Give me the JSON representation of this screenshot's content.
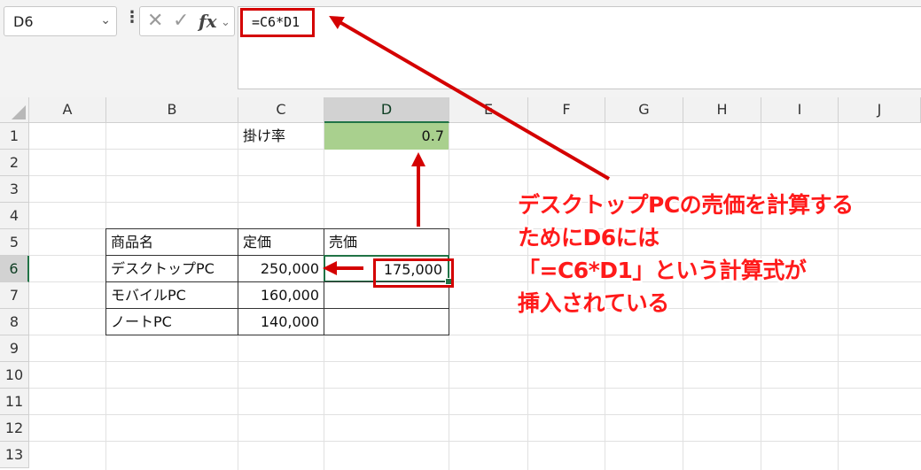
{
  "formula_bar": {
    "name_box": "D6",
    "formula": "=C6*D1",
    "icons": {
      "menu": "vertical-dots-icon",
      "cancel": "x-icon",
      "enter": "check-icon",
      "function": "fx-icon",
      "expand": "chevron-down-icon"
    }
  },
  "sheet": {
    "columns": [
      "A",
      "B",
      "C",
      "D",
      "E",
      "F",
      "G",
      "H",
      "I",
      "J"
    ],
    "selected_column": "D",
    "rows": [
      "1",
      "2",
      "3",
      "4",
      "5",
      "6",
      "7",
      "8",
      "9",
      "10",
      "11",
      "12",
      "13"
    ],
    "selected_row": "6",
    "cells": {
      "C1": "掛け率",
      "D1": "0.7",
      "B5": "商品名",
      "C5": "定価",
      "D5": "売価",
      "B6": "デスクトップPC",
      "C6": "250,000",
      "D6": "175,000",
      "B7": "モバイルPC",
      "C7": "160,000",
      "B8": "ノートPC",
      "C8": "140,000"
    }
  },
  "annotation": {
    "lines": [
      "デスクトップPCの売価を計算する",
      "ためにD6には",
      "「=C6*D1」という計算式が",
      "挿入されている"
    ]
  },
  "colors": {
    "highlight_red": "#d40000",
    "annotation_red": "#ff1a1a",
    "cell_fill_green": "#a9d08e",
    "excel_green": "#217346"
  }
}
